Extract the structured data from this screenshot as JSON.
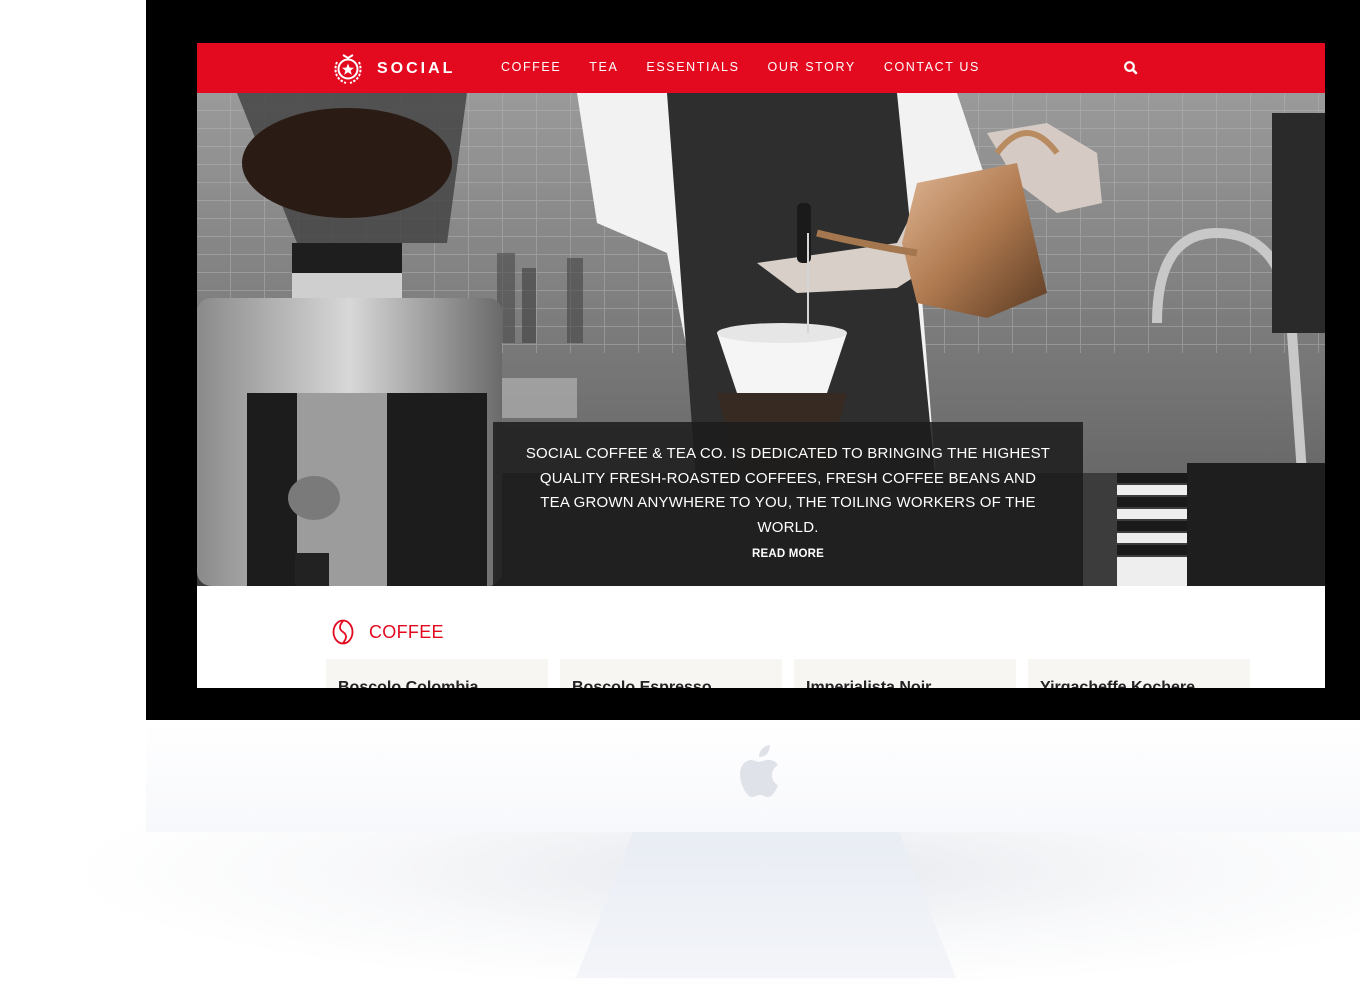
{
  "colors": {
    "brand_red": "#e30a20",
    "caption_bg": "#1c1c1c",
    "card_bg": "#f7f6f3"
  },
  "brand": {
    "name": "SOCIAL",
    "emblem_icon": "star-laurel-icon"
  },
  "nav": {
    "items": [
      {
        "label": "COFFEE"
      },
      {
        "label": "TEA"
      },
      {
        "label": "ESSENTIALS"
      },
      {
        "label": "OUR STORY"
      },
      {
        "label": "CONTACT US"
      }
    ],
    "search_icon": "search-icon"
  },
  "hero": {
    "text": "SOCIAL COFFEE & TEA CO. IS DEDICATED TO BRINGING THE HIGHEST QUALITY FRESH-ROASTED COFFEES, FRESH COFFEE BEANS AND TEA GROWN ANYWHERE TO YOU, THE TOILING WORKERS OF THE WORLD.",
    "cta": "READ MORE"
  },
  "products": {
    "section_title": "COFFEE",
    "section_icon": "coffee-bean-icon",
    "items": [
      {
        "name": "Boscolo Colombia"
      },
      {
        "name": "Boscolo Espresso"
      },
      {
        "name": "Imperialista Noir"
      },
      {
        "name": "Yirgacheffe Kochere"
      }
    ]
  },
  "device": {
    "logo_icon": "apple-logo-icon"
  }
}
